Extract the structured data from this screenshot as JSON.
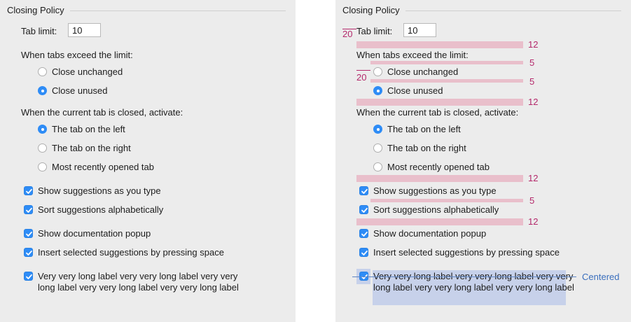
{
  "panels": {
    "left": {
      "group_title": "Closing Policy",
      "tab_limit": {
        "label": "Tab limit:",
        "value": "10"
      },
      "when_exceed_label": "When tabs exceed the limit:",
      "exceed_options": [
        {
          "label": "Close unchanged",
          "selected": false
        },
        {
          "label": "Close unused",
          "selected": true
        }
      ],
      "when_closed_label": "When the current tab is closed, activate:",
      "activate_options": [
        {
          "label": "The tab on the left",
          "selected": true
        },
        {
          "label": "The tab on the right",
          "selected": false
        },
        {
          "label": "Most recently opened tab",
          "selected": false
        }
      ],
      "checkboxes": [
        {
          "label": "Show suggestions as you type",
          "checked": true
        },
        {
          "label": "Sort suggestions alphabetically",
          "checked": true
        },
        {
          "label": "Show documentation popup",
          "checked": true
        },
        {
          "label": "Insert selected suggestions by pressing space",
          "checked": true
        },
        {
          "label": "Very very long label very very long label very very long label very very long label very very long label",
          "checked": true
        }
      ]
    },
    "right": {
      "group_title": "Closing Policy",
      "tab_limit": {
        "label": "Tab limit:",
        "value": "10"
      },
      "when_exceed_label": "When tabs exceed the limit:",
      "exceed_options": [
        {
          "label": "Close unchanged",
          "selected": false
        },
        {
          "label": "Close unused",
          "selected": true
        }
      ],
      "when_closed_label": "When the current tab is closed, activate:",
      "activate_options": [
        {
          "label": "The tab on the left",
          "selected": true
        },
        {
          "label": "The tab on the right",
          "selected": false
        },
        {
          "label": "Most recently opened tab",
          "selected": false
        }
      ],
      "checkboxes": [
        {
          "label": "Show suggestions as you type",
          "checked": true
        },
        {
          "label": "Sort suggestions alphabetically",
          "checked": true
        },
        {
          "label": "Show documentation popup",
          "checked": true
        },
        {
          "label": "Insert selected suggestions by pressing space",
          "checked": true
        },
        {
          "label": "Very very long label very very long label very very long label very very long label very very long label",
          "checked": true
        }
      ],
      "annotations": {
        "indent_tab_limit": "20",
        "indent_radio": "20",
        "gap_after_tab_limit": "12",
        "gap_label_to_radio": "5",
        "gap_between_radios": "5",
        "gap_after_radios": "12",
        "gap_after_activate_radios": "12",
        "gap_between_checkboxes": "5",
        "gap_after_checkbox_pair": "12",
        "centered_label": "Centered"
      }
    }
  },
  "colors": {
    "panel_bg": "#ececec",
    "accent": "#2e8cf6",
    "spacing_bar": "#e9bfcb",
    "spacing_text": "#b4296b",
    "highlight": "#c7d1ea",
    "centered_text": "#3b6fbd"
  }
}
